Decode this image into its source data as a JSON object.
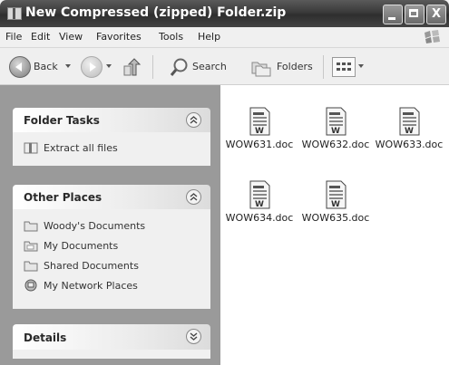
{
  "window": {
    "title": "New Compressed (zipped) Folder.zip",
    "controls": {
      "minimize": "",
      "maximize": "",
      "close": "X"
    }
  },
  "menu": [
    "File",
    "Edit",
    "View",
    "Favorites",
    "Tools",
    "Help"
  ],
  "toolbar": {
    "back_label": "Back",
    "search_label": "Search",
    "folders_label": "Folders"
  },
  "folder_tasks": {
    "title": "Folder Tasks",
    "items": [
      {
        "label": "Extract all files",
        "icon": "extract-icon"
      }
    ]
  },
  "other_places": {
    "title": "Other Places",
    "items": [
      {
        "label": "Woody's Documents",
        "icon": "folder-icon"
      },
      {
        "label": "My Documents",
        "icon": "folder-icon"
      },
      {
        "label": "Shared Documents",
        "icon": "folder-icon"
      },
      {
        "label": "My Network Places",
        "icon": "network-icon"
      }
    ]
  },
  "details": {
    "title": "Details"
  },
  "files": [
    {
      "name": "WOW631.doc",
      "icon": "word-document-icon"
    },
    {
      "name": "WOW632.doc",
      "icon": "word-document-icon"
    },
    {
      "name": "WOW633.doc",
      "icon": "word-document-icon"
    },
    {
      "name": "WOW634.doc",
      "icon": "word-document-icon"
    },
    {
      "name": "WOW635.doc",
      "icon": "word-document-icon"
    }
  ]
}
